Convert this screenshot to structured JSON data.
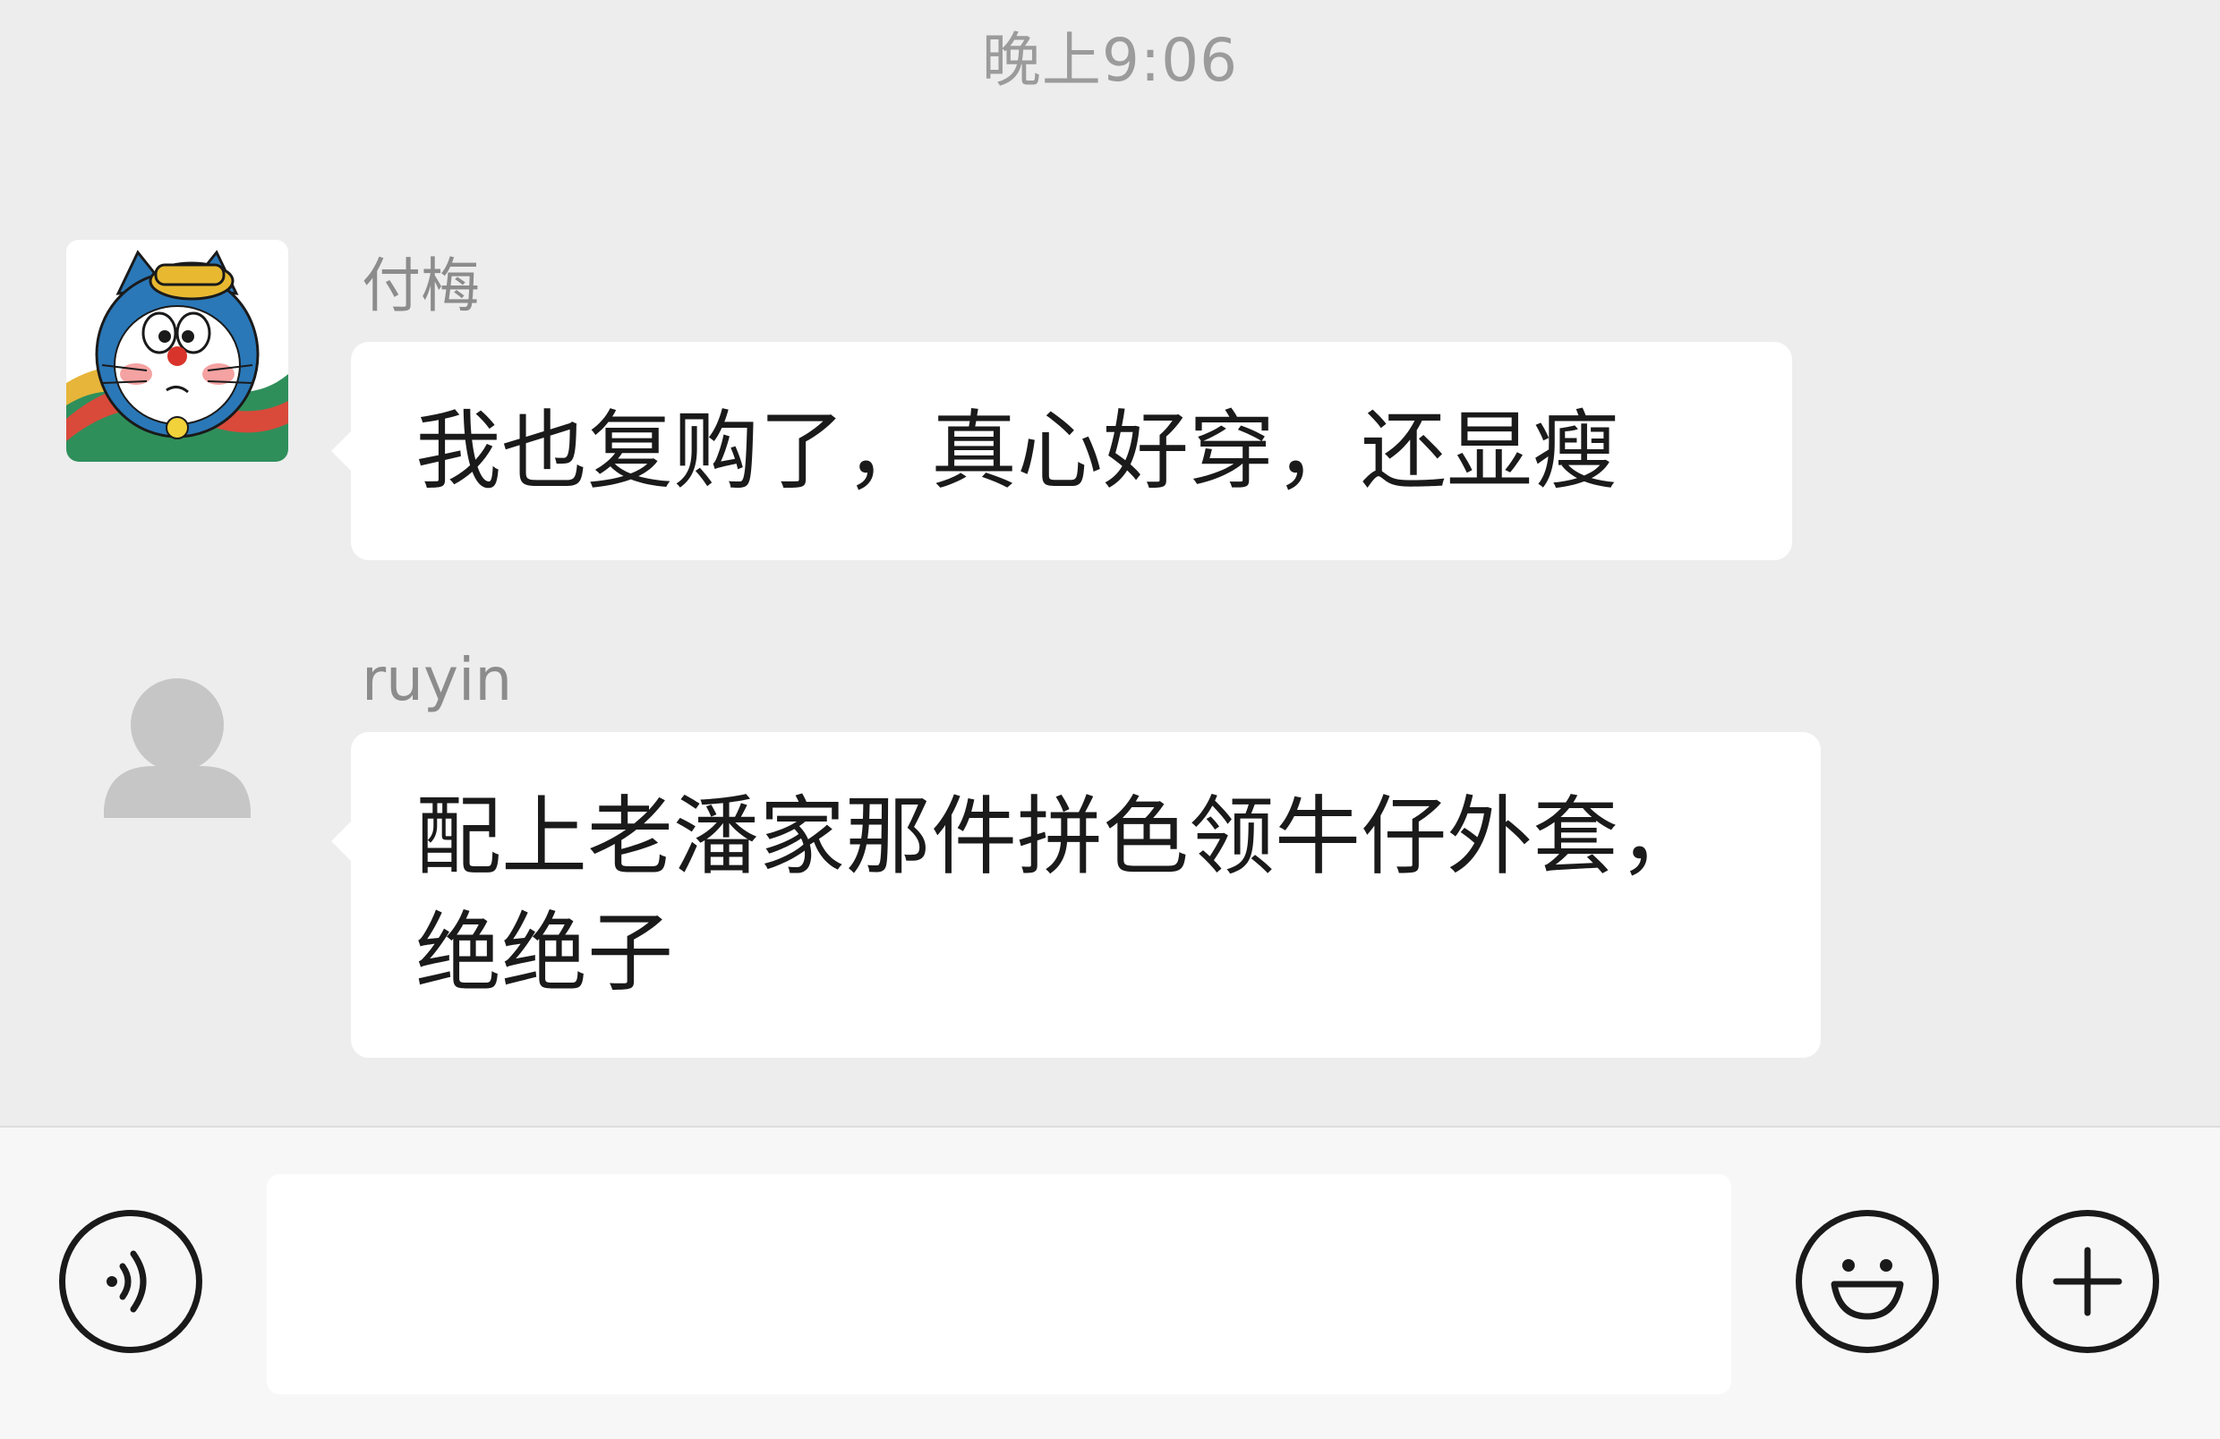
{
  "timestamp": "晚上9:06",
  "messages": [
    {
      "sender": "付梅",
      "avatar_icon": "cartoon-cat-avatar",
      "text": "我也复购了，真心好穿，还显瘦"
    },
    {
      "sender": "ruyin",
      "avatar_icon": "default-user-avatar",
      "text": "配上老潘家那件拼色领牛仔外套，绝绝子"
    }
  ],
  "input_bar": {
    "voice_icon": "voice-icon",
    "input_value": "",
    "emoji_icon": "smile-emoji-icon",
    "plus_icon": "plus-icon"
  },
  "colors": {
    "chat_background": "#ededed",
    "bubble": "#ffffff",
    "input_bar_background": "#f7f7f7",
    "secondary_text": "#8c8c8c"
  }
}
